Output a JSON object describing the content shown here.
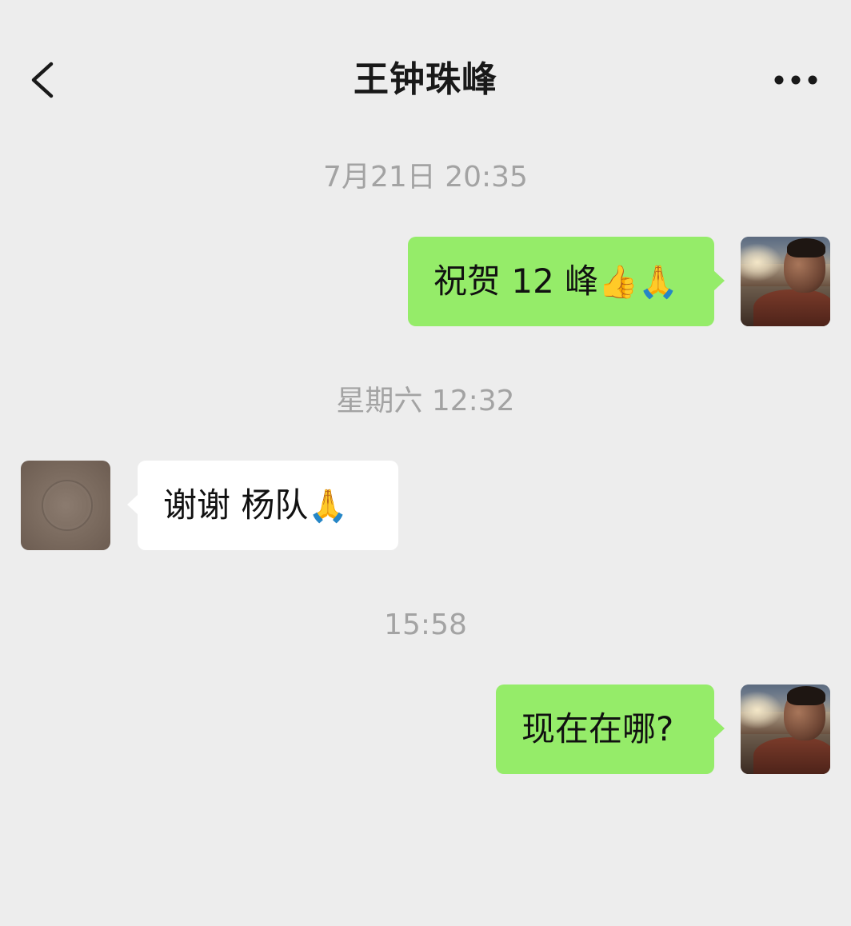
{
  "header": {
    "title": "王钟珠峰",
    "back_icon": "chevron-left-icon",
    "more_icon": "ellipsis-icon"
  },
  "messages": [
    {
      "type": "timestamp",
      "text": "7月21日 20:35"
    },
    {
      "type": "self",
      "text": "祝贺 12 峰",
      "emoji": "👍🙏",
      "bubble_color": "#95ec69"
    },
    {
      "type": "timestamp",
      "text": "星期六 12:32"
    },
    {
      "type": "other",
      "text": "谢谢 杨队",
      "emoji": "🙏",
      "bubble_color": "#ffffff"
    },
    {
      "type": "timestamp",
      "text": "15:58"
    },
    {
      "type": "self",
      "text": "现在在哪?",
      "bubble_color": "#95ec69"
    }
  ],
  "colors": {
    "background": "#ededed",
    "self_bubble": "#95ec69",
    "other_bubble": "#ffffff",
    "timestamp": "#a3a3a3",
    "title": "#191919"
  }
}
